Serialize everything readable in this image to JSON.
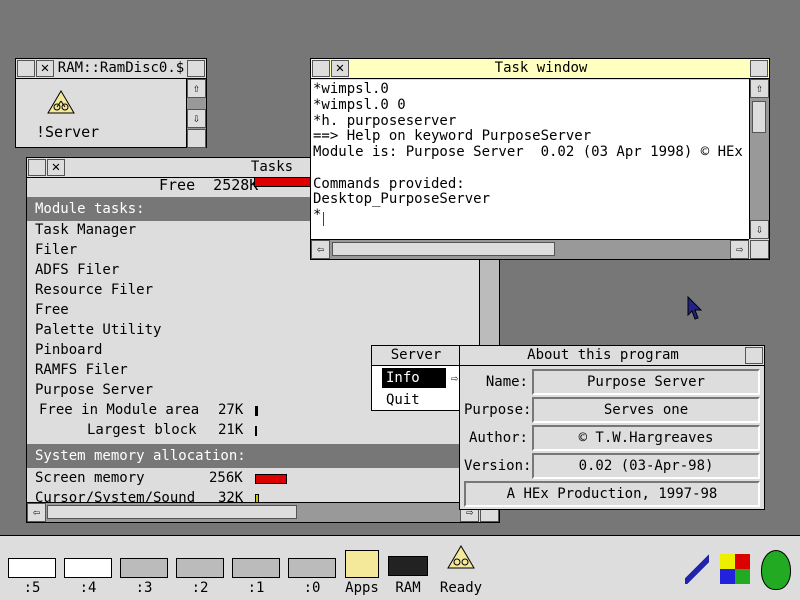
{
  "ramdisc": {
    "title": "RAM::RamDisc0.$",
    "file_label": "!Server"
  },
  "tasks": {
    "title": "Tasks",
    "free_line": "Free  2528K",
    "module_tasks_heading": "Module tasks:",
    "modules": [
      "Task Manager",
      "Filer",
      "ADFS Filer",
      "Resource Filer",
      "Free",
      "Palette Utility",
      "Pinboard",
      "RAMFS Filer",
      "Purpose Server"
    ],
    "free_in_module_area_label": "Free in Module area",
    "free_in_module_area_value": "27K",
    "largest_block_label": "Largest block",
    "largest_block_value": "21K",
    "system_alloc_heading": "System memory allocation:",
    "screen_memory_label": "Screen memory",
    "screen_memory_value": "256K",
    "cursor_label": "Cursor/System/Sound",
    "cursor_value": "32K"
  },
  "task_window": {
    "title": "Task window",
    "lines": [
      "*wimpsl.0",
      "*wimpsl.0 0",
      "*h. purposeserver",
      "==> Help on keyword PurposeServer",
      "Module is: Purpose Server  0.02 (03 Apr 1998) © HEx",
      "",
      "Commands provided:",
      "Desktop_PurposeServer",
      "*"
    ]
  },
  "server_menu": {
    "title": "Server",
    "items": [
      "Info",
      "Quit"
    ]
  },
  "about": {
    "title": "About this program",
    "name_label": "Name:",
    "name_value": "Purpose Server",
    "purpose_label": "Purpose:",
    "purpose_value": "Serves one",
    "author_label": "Author:",
    "author_value": "© T.W.Hargreaves",
    "version_label": "Version:",
    "version_value": "0.02 (03-Apr-98)",
    "footer": "A HEx Production, 1997-98"
  },
  "iconbar": {
    "drives": [
      ":5",
      ":4",
      ":3",
      ":2",
      ":1",
      ":0"
    ],
    "apps_label": "Apps",
    "ram_label": "RAM",
    "server_label": "Ready"
  },
  "colors": {
    "desktop": "#777777",
    "window": "#dddddd",
    "active_title": "#ffffc0",
    "bar_red": "#dd0000"
  }
}
